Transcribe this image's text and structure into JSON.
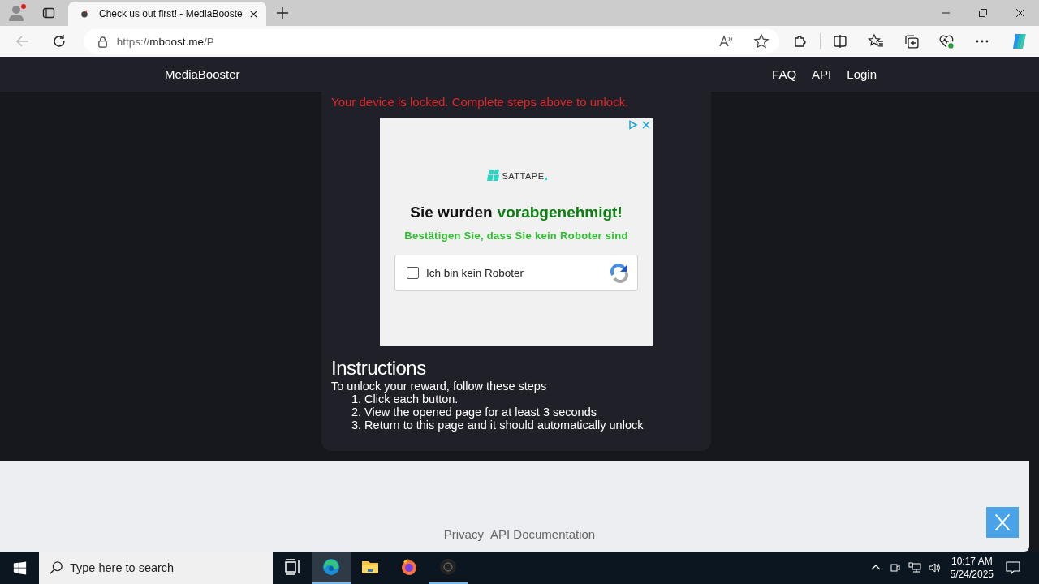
{
  "browser": {
    "tab_title": "Check us out first! - MediaBooste",
    "url_scheme": "https://",
    "url_host": "mboost.me",
    "url_path": "/P"
  },
  "nav": {
    "brand": "MediaBooster",
    "links": [
      "FAQ",
      "API",
      "Login"
    ]
  },
  "locked_message": "Your device is locked. Complete steps above to unlock.",
  "ad": {
    "logo_text": "SATTAPE",
    "heading_lead": "Sie wurden",
    "heading_highlight": "vorabgenehmigt!",
    "subheading": "Bestätigen Sie, dass Sie kein Roboter sind",
    "captcha": {
      "label": "Ich bin kein Roboter",
      "checked": false
    }
  },
  "instructions": {
    "title": "Instructions",
    "intro": "To unlock your reward, follow these steps",
    "steps": [
      {
        "number": "1.",
        "text": "Click each button."
      },
      {
        "number": "2.",
        "text": "View the opened page for at least 3 seconds"
      },
      {
        "number": "3.",
        "text": "Return to this page and it should automatically unlock"
      }
    ]
  },
  "footer": {
    "links": [
      "Privacy",
      "API Documentation"
    ]
  },
  "taskbar": {
    "search_placeholder": "Type here to search",
    "apps": [
      {
        "kind": "taskview",
        "running": false
      },
      {
        "kind": "edge",
        "running": true
      },
      {
        "kind": "explorer",
        "running": false
      },
      {
        "kind": "firefox",
        "running": false
      },
      {
        "kind": "app",
        "running": true
      }
    ],
    "time": "10:17 AM",
    "date": "5/24/2025"
  }
}
